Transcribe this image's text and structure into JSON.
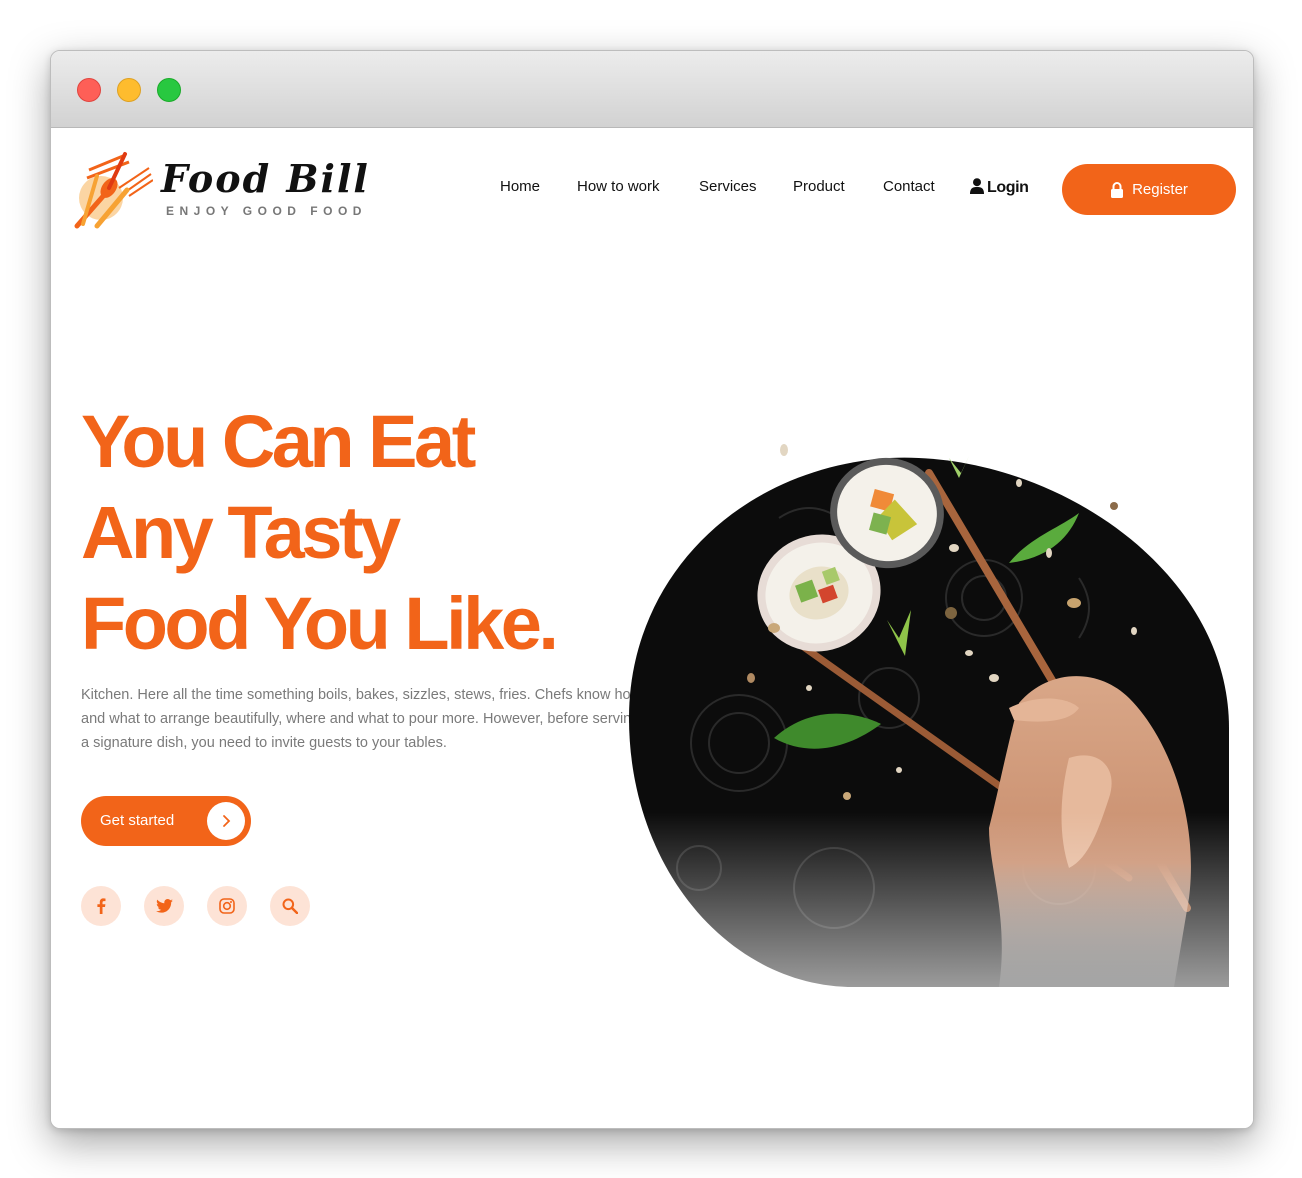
{
  "brand": {
    "title": "Food Bill",
    "tagline": "ENJOY GOOD FOOD",
    "accent": "#f26419",
    "accent_light": "#fde3d6"
  },
  "window": {
    "controls": [
      "close",
      "minimize",
      "maximize"
    ]
  },
  "nav": {
    "items": [
      {
        "label": "Home"
      },
      {
        "label": "How to work"
      },
      {
        "label": "Services"
      },
      {
        "label": "Product"
      },
      {
        "label": "Contact"
      }
    ],
    "login_label": "Login",
    "login_icon": "user-icon",
    "register_label": "Register",
    "register_icon": "lock-icon"
  },
  "hero": {
    "title_lines": [
      "You Can Eat",
      "Any Tasty",
      "Food You Like."
    ],
    "description": "Kitchen. Here all the time something boils, bakes, sizzles, stews, fries. Chefs know how and what to arrange beautifully, where and what to pour more. However, before serving a signature dish, you need to invite guests to your tables.",
    "cta_label": "Get started",
    "cta_icon": "chevron-right-icon",
    "image_alt": "Hand holding chopsticks with sushi rolls"
  },
  "social": [
    {
      "icon": "facebook-icon"
    },
    {
      "icon": "twitter-icon"
    },
    {
      "icon": "instagram-icon"
    },
    {
      "icon": "search-icon"
    }
  ]
}
